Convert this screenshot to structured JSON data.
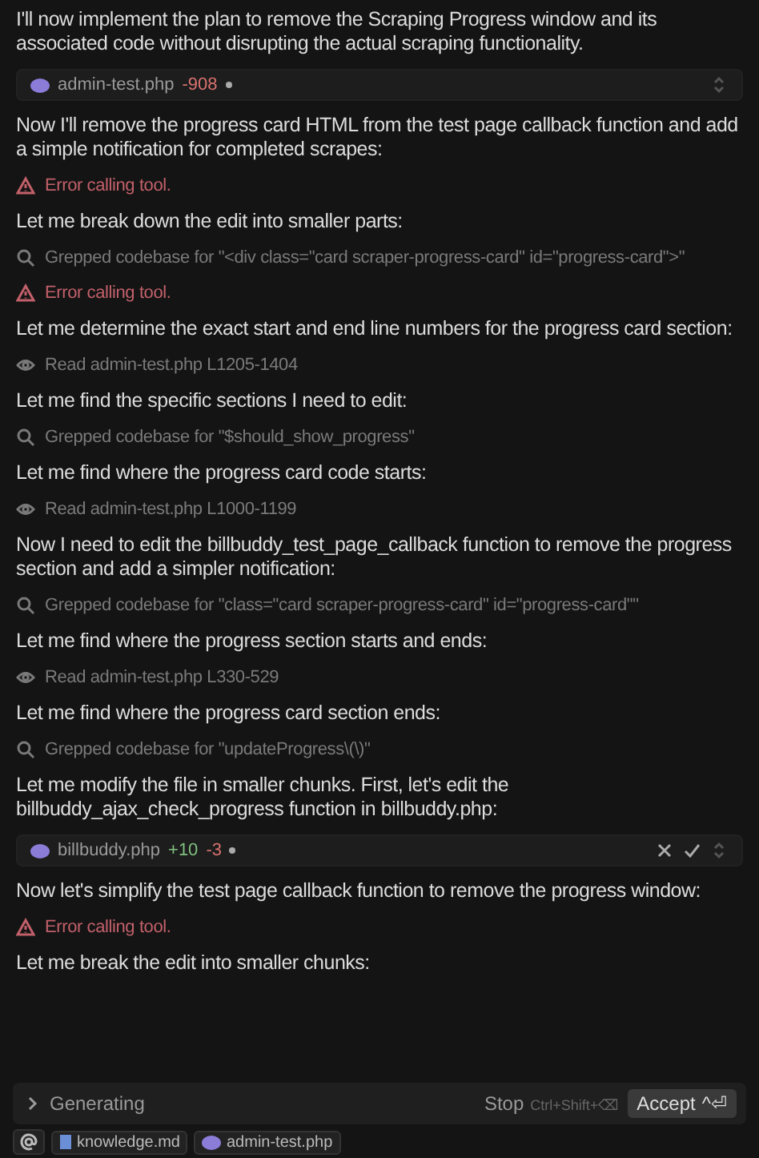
{
  "messages": [
    {
      "kind": "text",
      "text": "I'll now implement the plan to remove the Scraping Progress window and its associated code without disrupting the actual scraping functionality."
    },
    {
      "kind": "file",
      "name": "admin-test.php",
      "stats": [
        {
          "kind": "removed",
          "text": "-908"
        }
      ],
      "pending": false
    },
    {
      "kind": "text",
      "text": "Now I'll remove the progress card HTML from the test page callback function and add a simple notification for completed scrapes:"
    },
    {
      "kind": "error",
      "text": "Error calling tool."
    },
    {
      "kind": "text",
      "text": "Let me break down the edit into smaller parts:"
    },
    {
      "kind": "grep",
      "text": "Grepped codebase for \"<div class=\"card scraper-progress-card\" id=\"progress-card\">\""
    },
    {
      "kind": "error",
      "text": "Error calling tool."
    },
    {
      "kind": "text",
      "text": "Let me determine the exact start and end line numbers for the progress card section:"
    },
    {
      "kind": "read",
      "text": "Read admin-test.php L1205-1404"
    },
    {
      "kind": "text",
      "text": "Let me find the specific sections I need to edit:"
    },
    {
      "kind": "grep",
      "text": "Grepped codebase for \"$should_show_progress\""
    },
    {
      "kind": "text",
      "text": "Let me find where the progress card code starts:"
    },
    {
      "kind": "read",
      "text": "Read admin-test.php L1000-1199"
    },
    {
      "kind": "text",
      "text": "Now I need to edit the billbuddy_test_page_callback function to remove the progress section and add a simpler notification:"
    },
    {
      "kind": "grep",
      "text": "Grepped codebase for \"class=\"card scraper-progress-card\" id=\"progress-card\"\""
    },
    {
      "kind": "text",
      "text": "Let me find where the progress section starts and ends:"
    },
    {
      "kind": "read",
      "text": "Read admin-test.php L330-529"
    },
    {
      "kind": "text",
      "text": "Let me find where the progress card section ends:"
    },
    {
      "kind": "grep",
      "text": "Grepped codebase for \"updateProgress\\(\\)\""
    },
    {
      "kind": "text",
      "text": "Let me modify the file in smaller chunks. First, let's edit the billbuddy_ajax_check_progress function in billbuddy.php:"
    },
    {
      "kind": "file",
      "name": "billbuddy.php",
      "stats": [
        {
          "kind": "added",
          "text": "+10"
        },
        {
          "kind": "removed",
          "text": "-3"
        }
      ],
      "pending": true
    },
    {
      "kind": "text",
      "text": "Now let's simplify the test page callback function to remove the progress window:"
    },
    {
      "kind": "error",
      "text": "Error calling tool."
    },
    {
      "kind": "text",
      "text": "Let me break the edit into smaller chunks:"
    }
  ],
  "status_bar": {
    "label": "Generating",
    "stop": "Stop",
    "stop_shortcut": "Ctrl+Shift+⌫",
    "accept": "Accept",
    "accept_shortcut": "^⏎"
  },
  "context_chips": [
    {
      "kind": "markdown",
      "label": "knowledge.md"
    },
    {
      "kind": "php",
      "label": "admin-test.php"
    }
  ]
}
